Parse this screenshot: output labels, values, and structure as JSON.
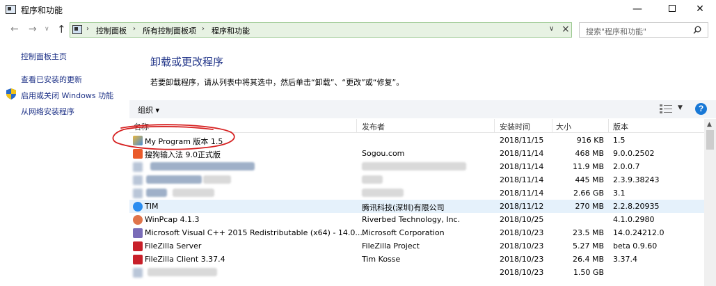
{
  "window": {
    "title": "程序和功能",
    "min": "—",
    "close": "✕"
  },
  "address": {
    "crumbs": [
      "控制面板",
      "所有控制面板项",
      "程序和功能"
    ],
    "search_placeholder": "搜索\"程序和功能\""
  },
  "sidebar": {
    "items": [
      {
        "label": "控制面板主页"
      },
      {
        "label": "查看已安装的更新"
      },
      {
        "label": "启用或关闭 Windows 功能"
      },
      {
        "label": "从网络安装程序"
      }
    ]
  },
  "main": {
    "title": "卸载或更改程序",
    "description": "若要卸载程序，请从列表中将其选中，然后单击“卸载”、“更改”或“修复”。"
  },
  "toolbar": {
    "organize": "组织 ▾",
    "help": "?"
  },
  "table": {
    "headers": [
      "名称",
      "发布者",
      "安装时间",
      "大小",
      "版本"
    ],
    "rows": [
      {
        "name": "My Program 版本 1.5",
        "publisher": "",
        "date": "2018/11/15",
        "size": "916 KB",
        "version": "1.5",
        "icon": "program-icon"
      },
      {
        "name": "搜狗输入法 9.0正式版",
        "publisher": "Sogou.com",
        "date": "2018/11/14",
        "size": "468 MB",
        "version": "9.0.0.2502",
        "icon": "sogou-icon"
      },
      {
        "name": "",
        "publisher": "",
        "date": "2018/11/14",
        "size": "11.9 MB",
        "version": "2.0.0.7",
        "icon": "blurred-icon"
      },
      {
        "name": "",
        "publisher": "",
        "date": "2018/11/14",
        "size": "445 MB",
        "version": "2.3.9.38243",
        "icon": "blurred-icon"
      },
      {
        "name": "",
        "publisher": "",
        "date": "2018/11/14",
        "size": "2.66 GB",
        "version": "3.1",
        "icon": "blurred-icon"
      },
      {
        "name": "TIM",
        "publisher": "腾讯科技(深圳)有限公司",
        "date": "2018/11/12",
        "size": "270 MB",
        "version": "2.2.8.20935",
        "icon": "tim-icon"
      },
      {
        "name": "WinPcap 4.1.3",
        "publisher": "Riverbed Technology, Inc.",
        "date": "2018/10/25",
        "size": "",
        "version": "4.1.0.2980",
        "icon": "winpcap-icon"
      },
      {
        "name": "Microsoft Visual C++ 2015 Redistributable (x64) - 14.0....",
        "publisher": "Microsoft Corporation",
        "date": "2018/10/23",
        "size": "23.5 MB",
        "version": "14.0.24212.0",
        "icon": "installer-icon"
      },
      {
        "name": "FileZilla Server",
        "publisher": "FileZilla Project",
        "date": "2018/10/23",
        "size": "5.27 MB",
        "version": "beta 0.9.60",
        "icon": "filezilla-icon"
      },
      {
        "name": "FileZilla Client 3.37.4",
        "publisher": "Tim Kosse",
        "date": "2018/10/23",
        "size": "26.4 MB",
        "version": "3.37.4",
        "icon": "filezilla-icon"
      },
      {
        "name": "",
        "publisher": "",
        "date": "2018/10/23",
        "size": "1.50 GB",
        "version": "",
        "icon": "blurred-icon"
      }
    ]
  },
  "colors": {
    "link": "#1e3287",
    "address_bg": "#e7f2e3",
    "selected_row": "#e5f1fb",
    "annotation": "#d62020"
  }
}
